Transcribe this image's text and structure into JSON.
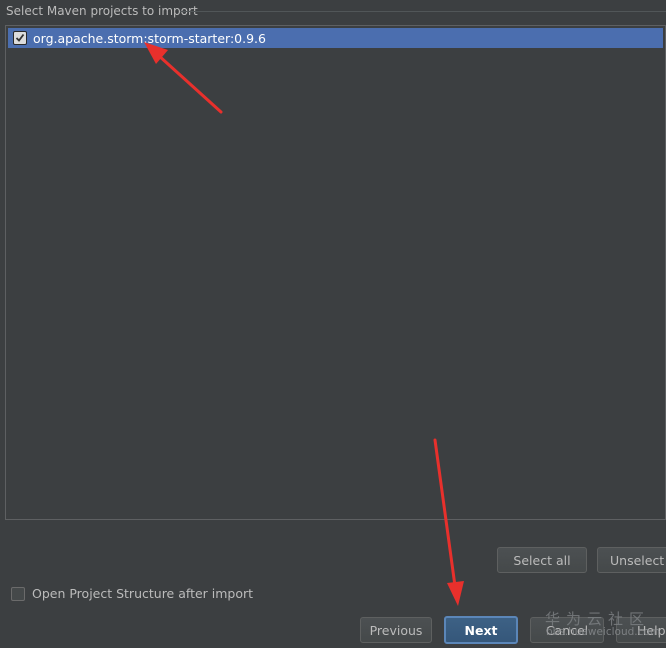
{
  "section_title": "Select Maven projects to import",
  "projects": [
    {
      "label": "org.apache.storm:storm-starter:0.9.6",
      "checked": true
    }
  ],
  "buttons": {
    "select_all": "Select all",
    "unselect": "Unselect",
    "previous": "Previous",
    "next": "Next",
    "cancel": "Cancel",
    "help": "Help"
  },
  "option": {
    "label": "Open Project Structure after import",
    "checked": false
  },
  "watermark": {
    "text": "华为云社区",
    "url": "bbs.huaweicloud.com"
  },
  "colors": {
    "background": "#3c3f41",
    "selection": "#4b6eaf",
    "annotation_arrow": "#e8302c"
  }
}
